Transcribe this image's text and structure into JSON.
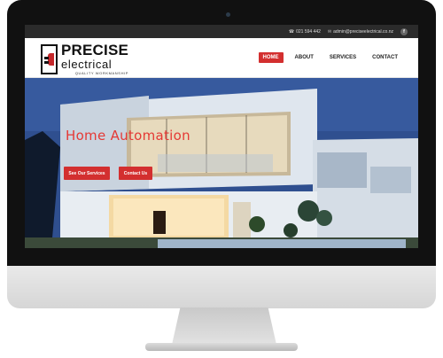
{
  "topbar": {
    "phone": "021 594 442",
    "email": "admin@preciseelectrical.co.nz",
    "social_icon": "f"
  },
  "logo": {
    "line1": "PRECISE",
    "line2": "electrical",
    "tagline": "QUALITY WORKMANSHIP"
  },
  "nav": {
    "items": [
      "HOME",
      "ABOUT",
      "SERVICES",
      "CONTACT"
    ],
    "active": "HOME"
  },
  "hero": {
    "title": "Home Automation",
    "primary_button": "See Our Services",
    "secondary_button": "Contact Us"
  },
  "colors": {
    "accent": "#d32f2f",
    "topbar": "#2b2b2b"
  }
}
